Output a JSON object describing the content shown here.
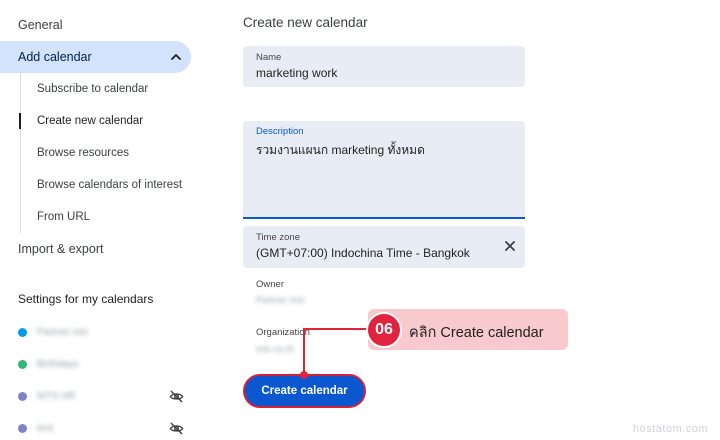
{
  "sidebar": {
    "general": "General",
    "add_calendar": "Add calendar",
    "sub_items": [
      "Subscribe to calendar",
      "Create new calendar",
      "Browse resources",
      "Browse calendars of interest",
      "From URL"
    ],
    "import_export": "Import & export",
    "settings_heading": "Settings for my calendars",
    "calendars": [
      {
        "name": "Partner mix",
        "color": "#039be5",
        "hidden": false
      },
      {
        "name": "Birthdays",
        "color": "#33b679",
        "hidden": false
      },
      {
        "name": "MTS HR",
        "color": "#7986cb",
        "hidden": true
      },
      {
        "name": "test",
        "color": "#7986cb",
        "hidden": true
      }
    ]
  },
  "main": {
    "title": "Create new calendar",
    "name": {
      "label": "Name",
      "value": "marketing work"
    },
    "description": {
      "label": "Description",
      "value": "รวมงานแผนก marketing ทั้งหมด"
    },
    "timezone": {
      "label": "Time zone",
      "value": "(GMT+07:00) Indochina Time - Bangkok"
    },
    "owner": {
      "label": "Owner",
      "value": "Partner mix"
    },
    "organization": {
      "label": "Organization",
      "value": "mix.co.th"
    },
    "create_button": "Create calendar"
  },
  "callout": {
    "number": "06",
    "text": "คลิก Create calendar"
  },
  "watermark": "hostatom.com",
  "colors": {
    "accent": "#0b57d0",
    "nav_active_bg": "#d3e3fd",
    "field_bg": "#e8edf5",
    "callout_red": "#e0243d",
    "callout_pill": "#f8c9cd"
  }
}
